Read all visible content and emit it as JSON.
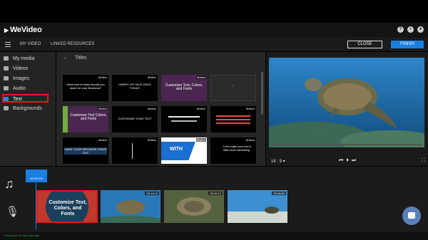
{
  "app": {
    "logo": "WeVideo"
  },
  "topbar": {
    "help_icon": "?",
    "bell_icon": "bell",
    "user_icon": "user"
  },
  "menubar": {
    "my_video": "MY VIDEO",
    "linked_resources": "LINKED RESOURCES",
    "close": "CLOSE",
    "finish": "FINISH"
  },
  "sidebar": {
    "items": [
      {
        "label": "My media"
      },
      {
        "label": "Videos"
      },
      {
        "label": "Images"
      },
      {
        "label": "Audio"
      },
      {
        "label": "Text"
      },
      {
        "label": "Backgrounds"
      }
    ]
  },
  "library": {
    "back": "←",
    "title": "Titles",
    "tiles": [
      {
        "badge": "Motion",
        "text": "What kind of ideas should you share for your Business?"
      },
      {
        "badge": "Motion",
        "text": "HURRY UP! SALE ENDS TODAY!"
      },
      {
        "badge": "Motion",
        "text": "Customize Text, Colors, and Fonts"
      },
      {
        "badge": "",
        "text": ""
      },
      {
        "badge": "Motion",
        "text": "Customize Text Colors, and Fonts"
      },
      {
        "badge": "Motion",
        "text": "CUSTOMIZE YOUR TEXT"
      },
      {
        "badge": "Motion",
        "text": ""
      },
      {
        "badge": "Motion",
        "text": ""
      },
      {
        "badge": "Motion",
        "text": "MAKE YOUR MESSAGE STAND OUT"
      },
      {
        "badge": "Motion",
        "text": ""
      },
      {
        "badge": "Motion",
        "text": "WITH"
      },
      {
        "badge": "Motion",
        "text": "Let's make your text a little more interesting"
      }
    ]
  },
  "preview": {
    "ratio": "16 : 9 ▾"
  },
  "timeline": {
    "playhead_time": "00:00:000",
    "title_clip": {
      "text": "Customize Text, Colors, and Fonts"
    },
    "clips": [
      {
        "duration": "00:14:13"
      },
      {
        "duration": "00:20:12"
      },
      {
        "duration": "00:16:00"
      }
    ]
  },
  "status": {
    "text": "Last saved 57 seconds ago"
  },
  "colors": {
    "accent": "#1a7fe0",
    "highlight": "#e01b1b"
  }
}
